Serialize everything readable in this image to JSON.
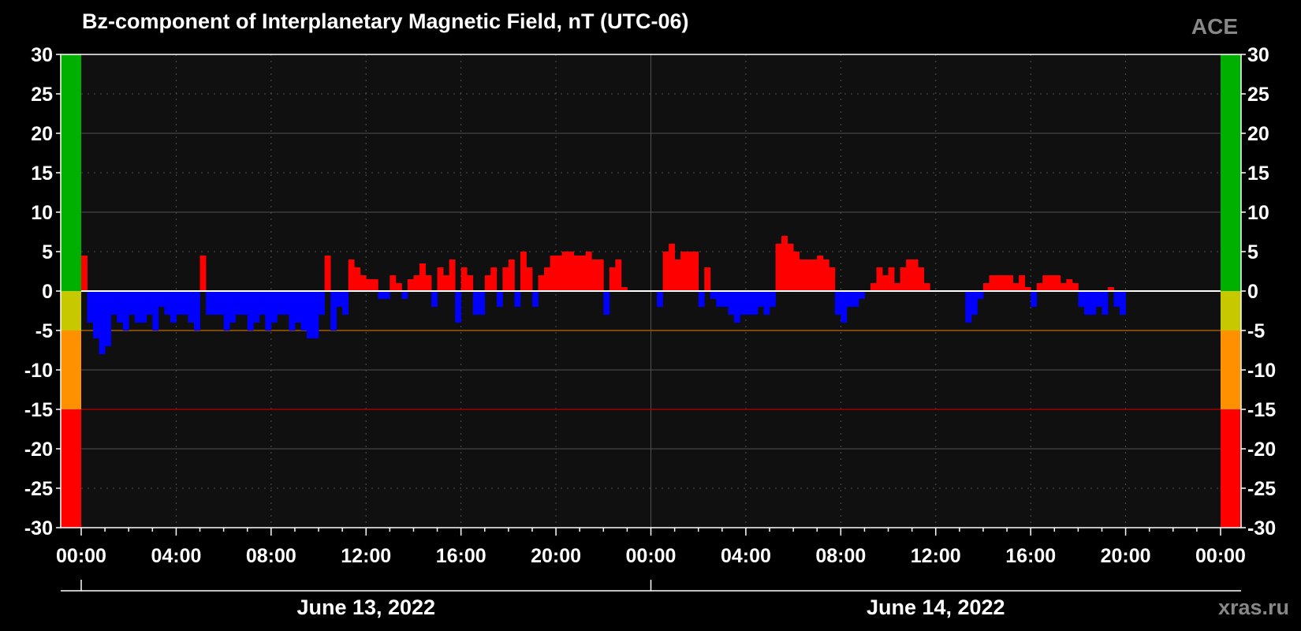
{
  "title": "Bz-component of Interplanetary Magnetic Field, nT (UTC-06)",
  "source": "ACE",
  "watermark": "xras.ru",
  "colors": {
    "positive": "#ff0000",
    "negative": "#0000ff",
    "background": "#000000",
    "plot_background": "#101010",
    "grid": "#505050",
    "zero_line": "#ffffff",
    "ref_line_minus5": "#a05a00",
    "ref_line_minus15": "#a00000"
  },
  "chart_data": {
    "type": "bar",
    "title": "Bz-component of Interplanetary Magnetic Field, nT (UTC-06)",
    "ylabel": "",
    "xlabel": "",
    "ylim": [
      -30,
      30
    ],
    "xlim_hours": [
      0,
      48
    ],
    "yticks": [
      30,
      25,
      20,
      15,
      10,
      5,
      0,
      -5,
      -10,
      -15,
      -20,
      -25,
      -30
    ],
    "xtick_labels": [
      "00:00",
      "04:00",
      "08:00",
      "12:00",
      "16:00",
      "20:00",
      "00:00",
      "04:00",
      "08:00",
      "12:00",
      "16:00",
      "20:00",
      "00:00"
    ],
    "date_labels": [
      "June 13, 2022",
      "June 14, 2022"
    ],
    "grid": true,
    "reference_lines": [
      -5,
      -15
    ],
    "color_bands": [
      {
        "from": 0,
        "to": 30,
        "color": "#00b000"
      },
      {
        "from": -5,
        "to": 0,
        "color": "#c8c800"
      },
      {
        "from": -15,
        "to": -5,
        "color": "#ff9000"
      },
      {
        "from": -30,
        "to": -15,
        "color": "#ff0000"
      }
    ],
    "series": [
      {
        "hours": [
          0.0,
          0.25,
          0.5,
          0.75,
          1.0,
          1.25,
          1.5,
          1.75,
          2.0,
          2.25,
          2.5,
          2.75,
          3.0,
          3.25,
          3.5,
          3.75,
          4.0,
          4.25,
          4.5,
          4.75,
          5.0,
          5.25,
          5.5,
          5.75,
          6.0,
          6.25,
          6.5,
          6.75,
          7.0,
          7.25,
          7.5,
          7.75,
          8.0,
          8.25,
          8.5,
          8.75,
          9.0,
          9.25,
          9.5,
          9.75,
          10.0,
          10.25,
          10.5,
          10.75,
          11.0,
          11.25,
          11.5,
          11.75,
          12.0,
          12.25,
          12.5,
          12.75,
          13.0,
          13.25,
          13.5,
          13.75,
          14.0,
          14.25,
          14.5,
          14.75,
          15.0,
          15.25,
          15.5,
          15.75,
          16.0,
          16.25,
          16.5,
          16.75,
          17.0,
          17.25,
          17.5,
          17.75,
          18.0,
          18.25,
          18.5,
          18.75,
          19.0,
          19.25,
          19.5,
          19.75,
          20.0,
          20.25,
          20.5,
          20.75,
          21.0,
          21.25,
          21.5,
          21.75,
          22.0,
          22.25,
          22.5,
          22.75,
          23.0,
          23.25,
          23.5,
          23.75,
          24.0,
          24.25,
          24.5,
          24.75,
          25.0,
          25.25,
          25.5,
          25.75,
          26.0,
          26.25,
          26.5,
          26.75,
          27.0,
          27.25,
          27.5,
          27.75,
          28.0,
          28.25,
          28.5,
          28.75,
          29.0,
          29.25,
          29.5,
          29.75,
          30.0,
          30.25,
          30.5,
          30.75,
          31.0,
          31.25,
          31.5,
          31.75,
          32.0,
          32.25,
          32.5,
          32.75,
          33.0,
          33.25,
          33.5,
          33.75,
          34.0,
          34.25,
          34.5,
          34.75,
          35.0,
          35.25,
          35.5,
          35.75,
          36.0,
          36.25,
          36.5,
          36.75,
          37.0,
          37.25,
          37.5,
          37.75,
          38.0,
          38.25,
          38.5,
          38.75,
          39.0,
          39.25,
          39.5,
          39.75,
          40.0,
          40.25,
          40.5,
          40.75,
          41.0,
          41.25,
          41.5,
          41.75,
          42.0,
          42.25,
          42.5,
          42.75,
          43.0,
          43.25,
          43.5,
          43.75,
          44.0,
          44.25,
          44.5,
          44.75,
          45.0,
          45.25,
          45.5
        ],
        "values": [
          4.5,
          -4,
          -6,
          -8,
          -7,
          -3,
          -4,
          -5,
          -3,
          -4,
          -4,
          -3,
          -5,
          -2,
          -3,
          -4,
          -3,
          -3,
          -4,
          -5,
          4.5,
          -3,
          -3,
          -3,
          -5,
          -4,
          -3,
          -3,
          -5,
          -4,
          -3,
          -5,
          -4,
          -3,
          -3,
          -5,
          -4,
          -5,
          -6,
          -6,
          -3,
          4.5,
          -5,
          -2,
          -3,
          4,
          3,
          2,
          1.5,
          1.5,
          -1,
          -1,
          2,
          1,
          -1,
          1.5,
          2,
          3.5,
          2,
          -2,
          3,
          2,
          4,
          -4,
          3,
          2,
          -3,
          -3,
          2,
          3,
          -2,
          3,
          4,
          -2,
          5,
          3,
          -2,
          2,
          3,
          4.5,
          4.5,
          5,
          5,
          4.5,
          4.5,
          5,
          4,
          4,
          -3,
          3,
          4,
          0.5,
          0,
          0,
          0,
          0,
          0,
          -2,
          5,
          6,
          4,
          5,
          5,
          5,
          -2,
          3,
          -1,
          -2,
          -2,
          -3,
          -4,
          -3,
          -3,
          -3,
          -2,
          -3,
          -2,
          6,
          7,
          6,
          5,
          4,
          4,
          4,
          4.5,
          4,
          3,
          -3,
          -4,
          -2,
          -2,
          -1,
          0,
          1,
          3,
          2,
          3,
          1,
          3,
          4,
          4,
          3,
          1,
          0,
          0,
          0,
          0,
          0,
          0,
          -4,
          -3,
          -1,
          1,
          2,
          2,
          2,
          2,
          1,
          2,
          0.5,
          -2,
          1,
          2,
          2,
          2,
          1,
          1.5,
          1,
          -2,
          -3,
          -3,
          -2,
          -3,
          0.5,
          -2,
          -3
        ]
      }
    ]
  }
}
